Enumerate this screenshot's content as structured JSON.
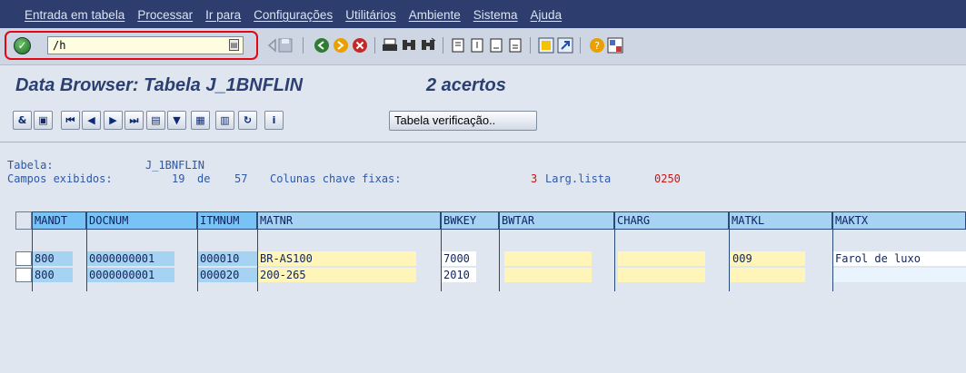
{
  "menu": {
    "items": [
      "Entrada em tabela",
      "Processar",
      "Ir para",
      "Configurações",
      "Utilitários",
      "Ambiente",
      "Sistema",
      "Ajuda"
    ]
  },
  "toolbar": {
    "command_value": "/h",
    "icons": [
      "enter-icon",
      "back-arrow-icon",
      "save-icon",
      "back-icon",
      "exit-icon",
      "cancel-icon",
      "print-icon",
      "find-icon",
      "find-next-icon",
      "first-page-icon",
      "previous-page-icon",
      "next-page-icon",
      "last-page-icon",
      "create-session-icon",
      "shortcut-icon",
      "help-icon",
      "layout-icon"
    ]
  },
  "title": {
    "main": "Data Browser: Tabela J_1BNFLIN",
    "hits": "2 acertos"
  },
  "app_toolbar": {
    "buttons": [
      "glasses-icon",
      "detail-icon",
      "first-icon",
      "previous-icon",
      "next-icon",
      "last-icon",
      "print-icon",
      "filter-icon",
      "export-icon",
      "choose-layout-icon",
      "refresh-icon",
      "info-icon"
    ],
    "check_table_label": "Tabela verificação.."
  },
  "info": {
    "table_label": "Tabela:",
    "table_value": "J_1BNFLIN",
    "fields_label": "Campos exibidos:",
    "fields_shown": "19",
    "fields_of": "de",
    "fields_total": "57",
    "key_cols_label": "Colunas chave fixas:",
    "key_cols_value": "3",
    "width_label": "Larg.lista",
    "width_value": "0250"
  },
  "grid": {
    "columns": [
      "MANDT",
      "DOCNUM",
      "ITMNUM",
      "MATNR",
      "BWKEY",
      "BWTAR",
      "CHARG",
      "MATKL",
      "MAKTX"
    ],
    "rows": [
      [
        "800",
        "0000000001",
        "000010",
        "BR-AS100",
        "7000",
        "",
        "",
        "009",
        "Farol de luxo"
      ],
      [
        "800",
        "0000000001",
        "000020",
        "200-265",
        "2010",
        "",
        "",
        "",
        ""
      ]
    ]
  },
  "colors": {
    "menubar_bg": "#2c3d6e",
    "title_text": "#2b3f70",
    "key_column": "#a7d3f2",
    "data_cell": "#fff5b8",
    "highlight_outline": "#e30613"
  }
}
